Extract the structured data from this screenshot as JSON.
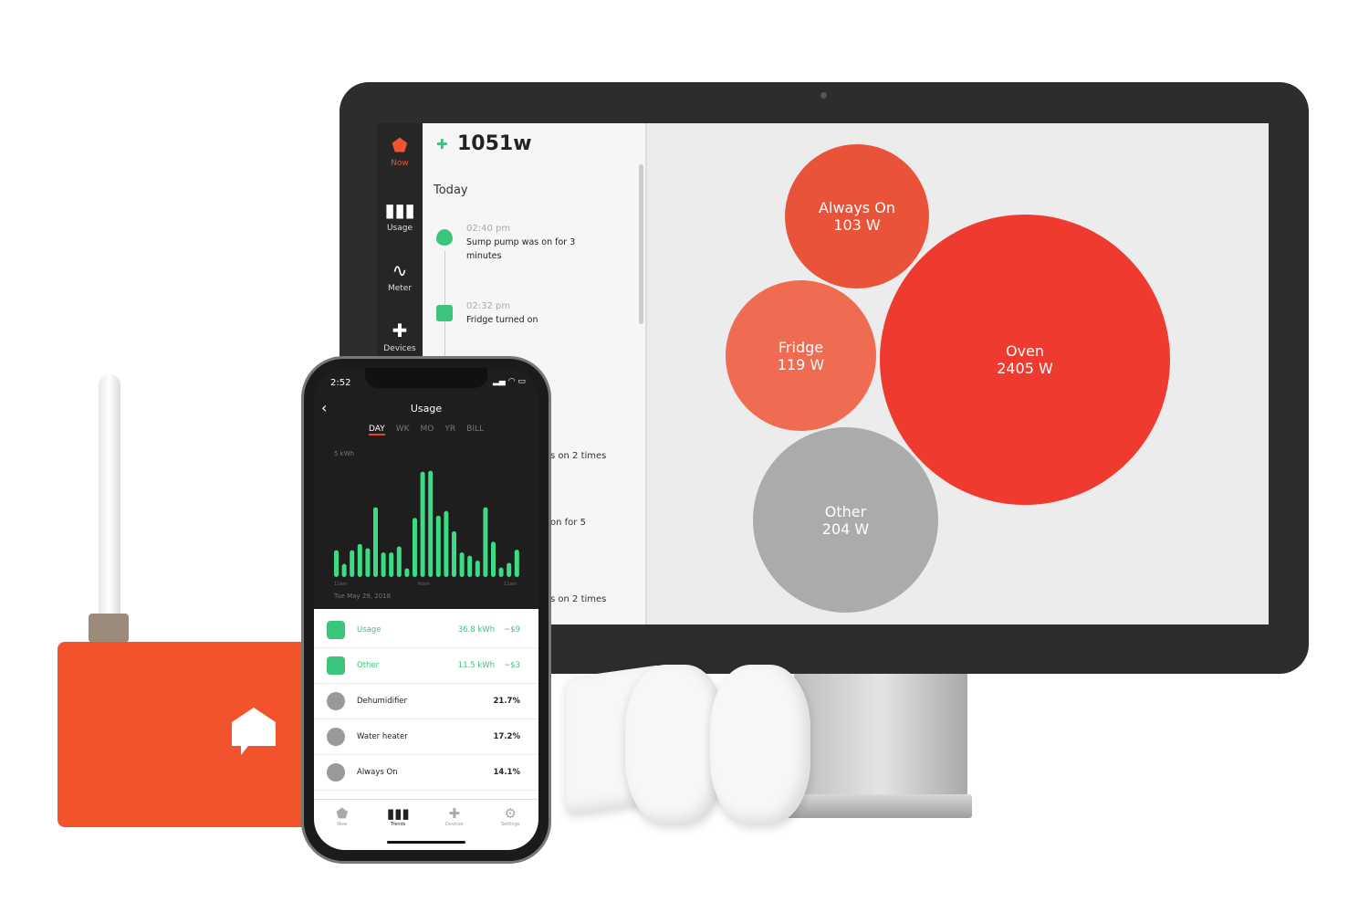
{
  "desktop": {
    "sidebar": [
      {
        "label": "Now",
        "icon": "home-icon",
        "active": true
      },
      {
        "label": "Usage",
        "icon": "bar-chart-icon"
      },
      {
        "label": "Meter",
        "icon": "pulse-icon"
      },
      {
        "label": "Devices",
        "icon": "plug-icon"
      }
    ],
    "power": "1051w",
    "section": "Today",
    "events": [
      {
        "time": "02:40 pm",
        "text": "Sump pump was on for 3 minutes",
        "icon": "water-drop-icon"
      },
      {
        "time": "02:32 pm",
        "text": "Fridge turned on",
        "icon": "fridge-icon"
      }
    ],
    "partial_events": [
      "s on 2 times",
      "on for 5",
      "s on 2 times"
    ],
    "bubbles": [
      {
        "name": "Always On",
        "value": "103 W",
        "color": "#e8533a"
      },
      {
        "name": "Fridge",
        "value": "119 W",
        "color": "#ef6b52"
      },
      {
        "name": "Oven",
        "value": "2405 W",
        "color": "#ee3a2f"
      },
      {
        "name": "Other",
        "value": "204 W",
        "color": "#ababab"
      }
    ]
  },
  "phone": {
    "time": "2:52",
    "title": "Usage",
    "tabs": [
      "DAY",
      "WK",
      "MO",
      "YR",
      "BILL"
    ],
    "active_tab": "DAY",
    "date": "Tue May 29, 2018",
    "chart_data": {
      "type": "bar",
      "ylabel": "5 kWh",
      "ylim": [
        0,
        5
      ],
      "xticks": [
        "12am",
        "Noon",
        "12am"
      ],
      "values": [
        1.08,
        0.53,
        1.08,
        1.33,
        1.16,
        2.81,
        0.99,
        0.99,
        1.23,
        0.35,
        2.38,
        4.24,
        4.28,
        2.47,
        2.66,
        1.84,
        0.99,
        0.86,
        0.66,
        2.81,
        1.42,
        0.38,
        0.57,
        1.1
      ],
      "color": "#3ddc84"
    },
    "list": [
      {
        "label": "Usage",
        "value": "36.8 kWh",
        "cost": "~$9",
        "highlight": true,
        "icon": "plug-icon"
      },
      {
        "label": "Other",
        "value": "11.5 kWh",
        "cost": "~$3",
        "highlight": true,
        "icon": "home-icon"
      },
      {
        "label": "Dehumidifier",
        "value": "21.7%",
        "icon": "dehumidifier-icon"
      },
      {
        "label": "Water heater",
        "value": "17.2%",
        "icon": "water-drop-icon"
      },
      {
        "label": "Always On",
        "value": "14.1%",
        "icon": "refresh-icon"
      }
    ],
    "tabbar": [
      "Now",
      "Trends",
      "Devices",
      "Settings"
    ],
    "active_tabbar": "Trends"
  },
  "colors": {
    "brand": "#f2532d",
    "green": "#3cc47c"
  }
}
